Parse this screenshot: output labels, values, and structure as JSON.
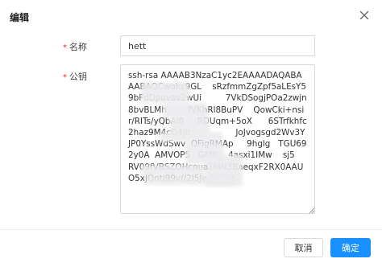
{
  "dialog": {
    "title": "编辑"
  },
  "form": {
    "name": {
      "required_mark": "*",
      "label": "名称",
      "value": "hett"
    },
    "public_key": {
      "required_mark": "*",
      "label": "公钥",
      "value": "ssh-rsa AAAAB3NzaC1yc2EAAAADAQABAAABAQCwokc9GL    sRzfmmZgZpf5aLEsY59bFdDpovav2wUi         7VkDSogjPOa2zwjn8bvBLMh        fVKhRl8BuPV    QowCki+nsir/RITs/yQbAi0     RDUqm+5oX      6STrfkhfc2haz9M4cQ4jh                 JoJvogsgd2Wv3YJP0YssWdSwv  QFigRMAp     9hglg   TGU692y0A  AMVOP5   GMK    4asxi1IMw    sj5              RV09fVBSZOHcouaTMN3BaeqxF2RX0AAUO5xJOnti99v//2I5JwAUSKt"
    }
  },
  "footer": {
    "cancel_label": "取消",
    "ok_label": "确定"
  },
  "colors": {
    "primary": "#1890ff",
    "required": "#f5222d",
    "border": "#d9d9d9"
  },
  "icons": {
    "close": "close-icon",
    "resize": "resize-grip-icon"
  }
}
